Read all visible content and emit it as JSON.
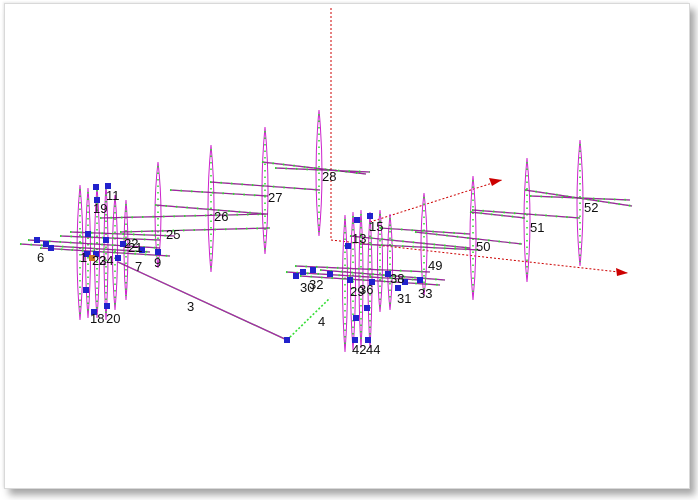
{
  "colors": {
    "background": "#ffffff",
    "element_line": "#cc22cc",
    "element_outline": "#2a2a2a",
    "node_dot": "#33dd33",
    "node_marker": "#2222cc",
    "selected_node": "#cc7722",
    "axis": "#cc0000"
  },
  "labels": {
    "l1": "1",
    "l3": "3",
    "l4": "4",
    "l6": "6",
    "l7": "7",
    "l9": "9",
    "l11": "11",
    "l13": "13",
    "l15": "15",
    "l18": "18",
    "l19": "19",
    "l20": "20",
    "l21": "21",
    "l22": "22",
    "l23": "23",
    "l24": "24",
    "l25": "25",
    "l26": "26",
    "l27": "27",
    "l28": "28",
    "l29": "29",
    "l30": "30",
    "l31": "31",
    "l32": "32",
    "l33": "33",
    "l36": "36",
    "l38": "38",
    "l42": "42",
    "l44": "44",
    "l49": "49",
    "l50": "50",
    "l51": "51",
    "l52": "52"
  }
}
